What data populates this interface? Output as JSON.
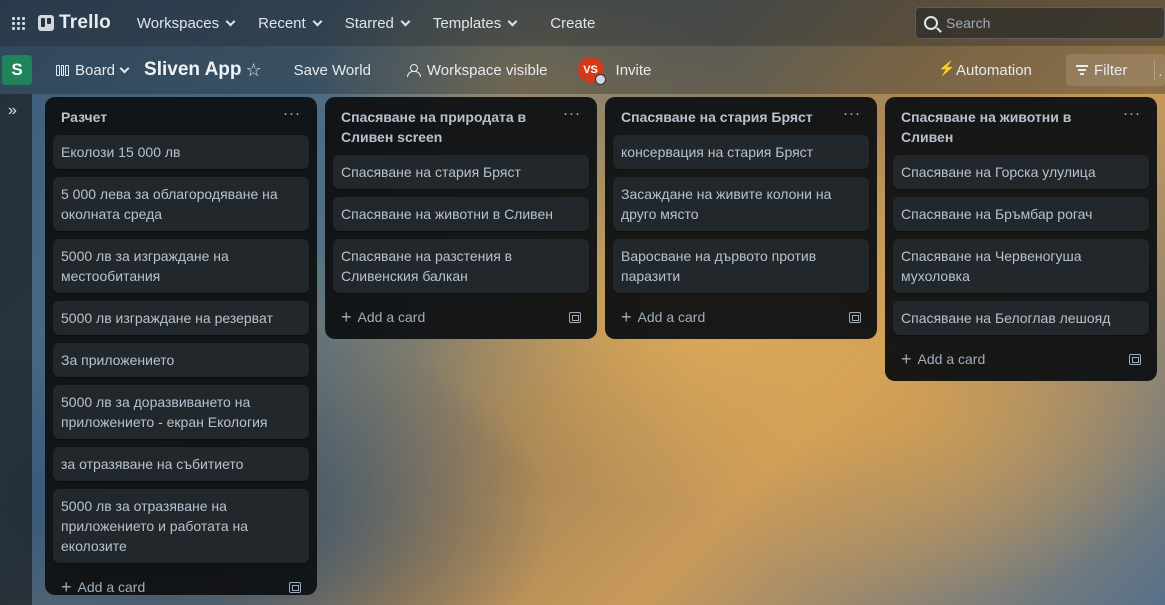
{
  "topbar": {
    "brand": "Trello",
    "nav": [
      "Workspaces",
      "Recent",
      "Starred",
      "Templates"
    ],
    "create": "Create",
    "search_placeholder": "Search"
  },
  "boardbar": {
    "workspace_initial": "S",
    "view": "Board",
    "title": "Sliven App",
    "save_world": "Save World",
    "visibility": "Workspace visible",
    "member_initials": "VS",
    "invite": "Invite",
    "automation": "Automation",
    "filter": "Filter"
  },
  "lists": [
    {
      "title": "Разчет",
      "cards": [
        "Еколози 15 000 лв",
        "5 000 лева за облагородяване на околната среда",
        "5000 лв за изграждане на местообитания",
        "5000 лв изграждане на резерват",
        "За приложението",
        "5000 лв за доразвиването на приложението - екран Екология",
        "за отразяване на събитието",
        "5000 лв за отразяване на приложението и работата на еколозите"
      ],
      "add_label": "Add a card"
    },
    {
      "title": "Спасяване на природата в Сливен screen",
      "cards": [
        "Спасяване на стария Бряст",
        "Спасяване на животни в Сливен",
        "Спасяване на разстения в Сливенския балкан"
      ],
      "add_label": "Add a card"
    },
    {
      "title": "Спасяване на стария Бряст",
      "cards": [
        "консервация на стария Бряст",
        "Засаждане на живите колони на друго място",
        "Варосване на дървото против паразити"
      ],
      "add_label": "Add a card"
    },
    {
      "title": "Спасяване на животни в Сливен",
      "cards": [
        "Спасяване на Горска улулица",
        "Спасяване на Бръмбар рогач",
        "Спасяване на Червеногуша мухоловка",
        "Спасяване на Белоглав лешояд"
      ],
      "add_label": "Add a card"
    }
  ]
}
